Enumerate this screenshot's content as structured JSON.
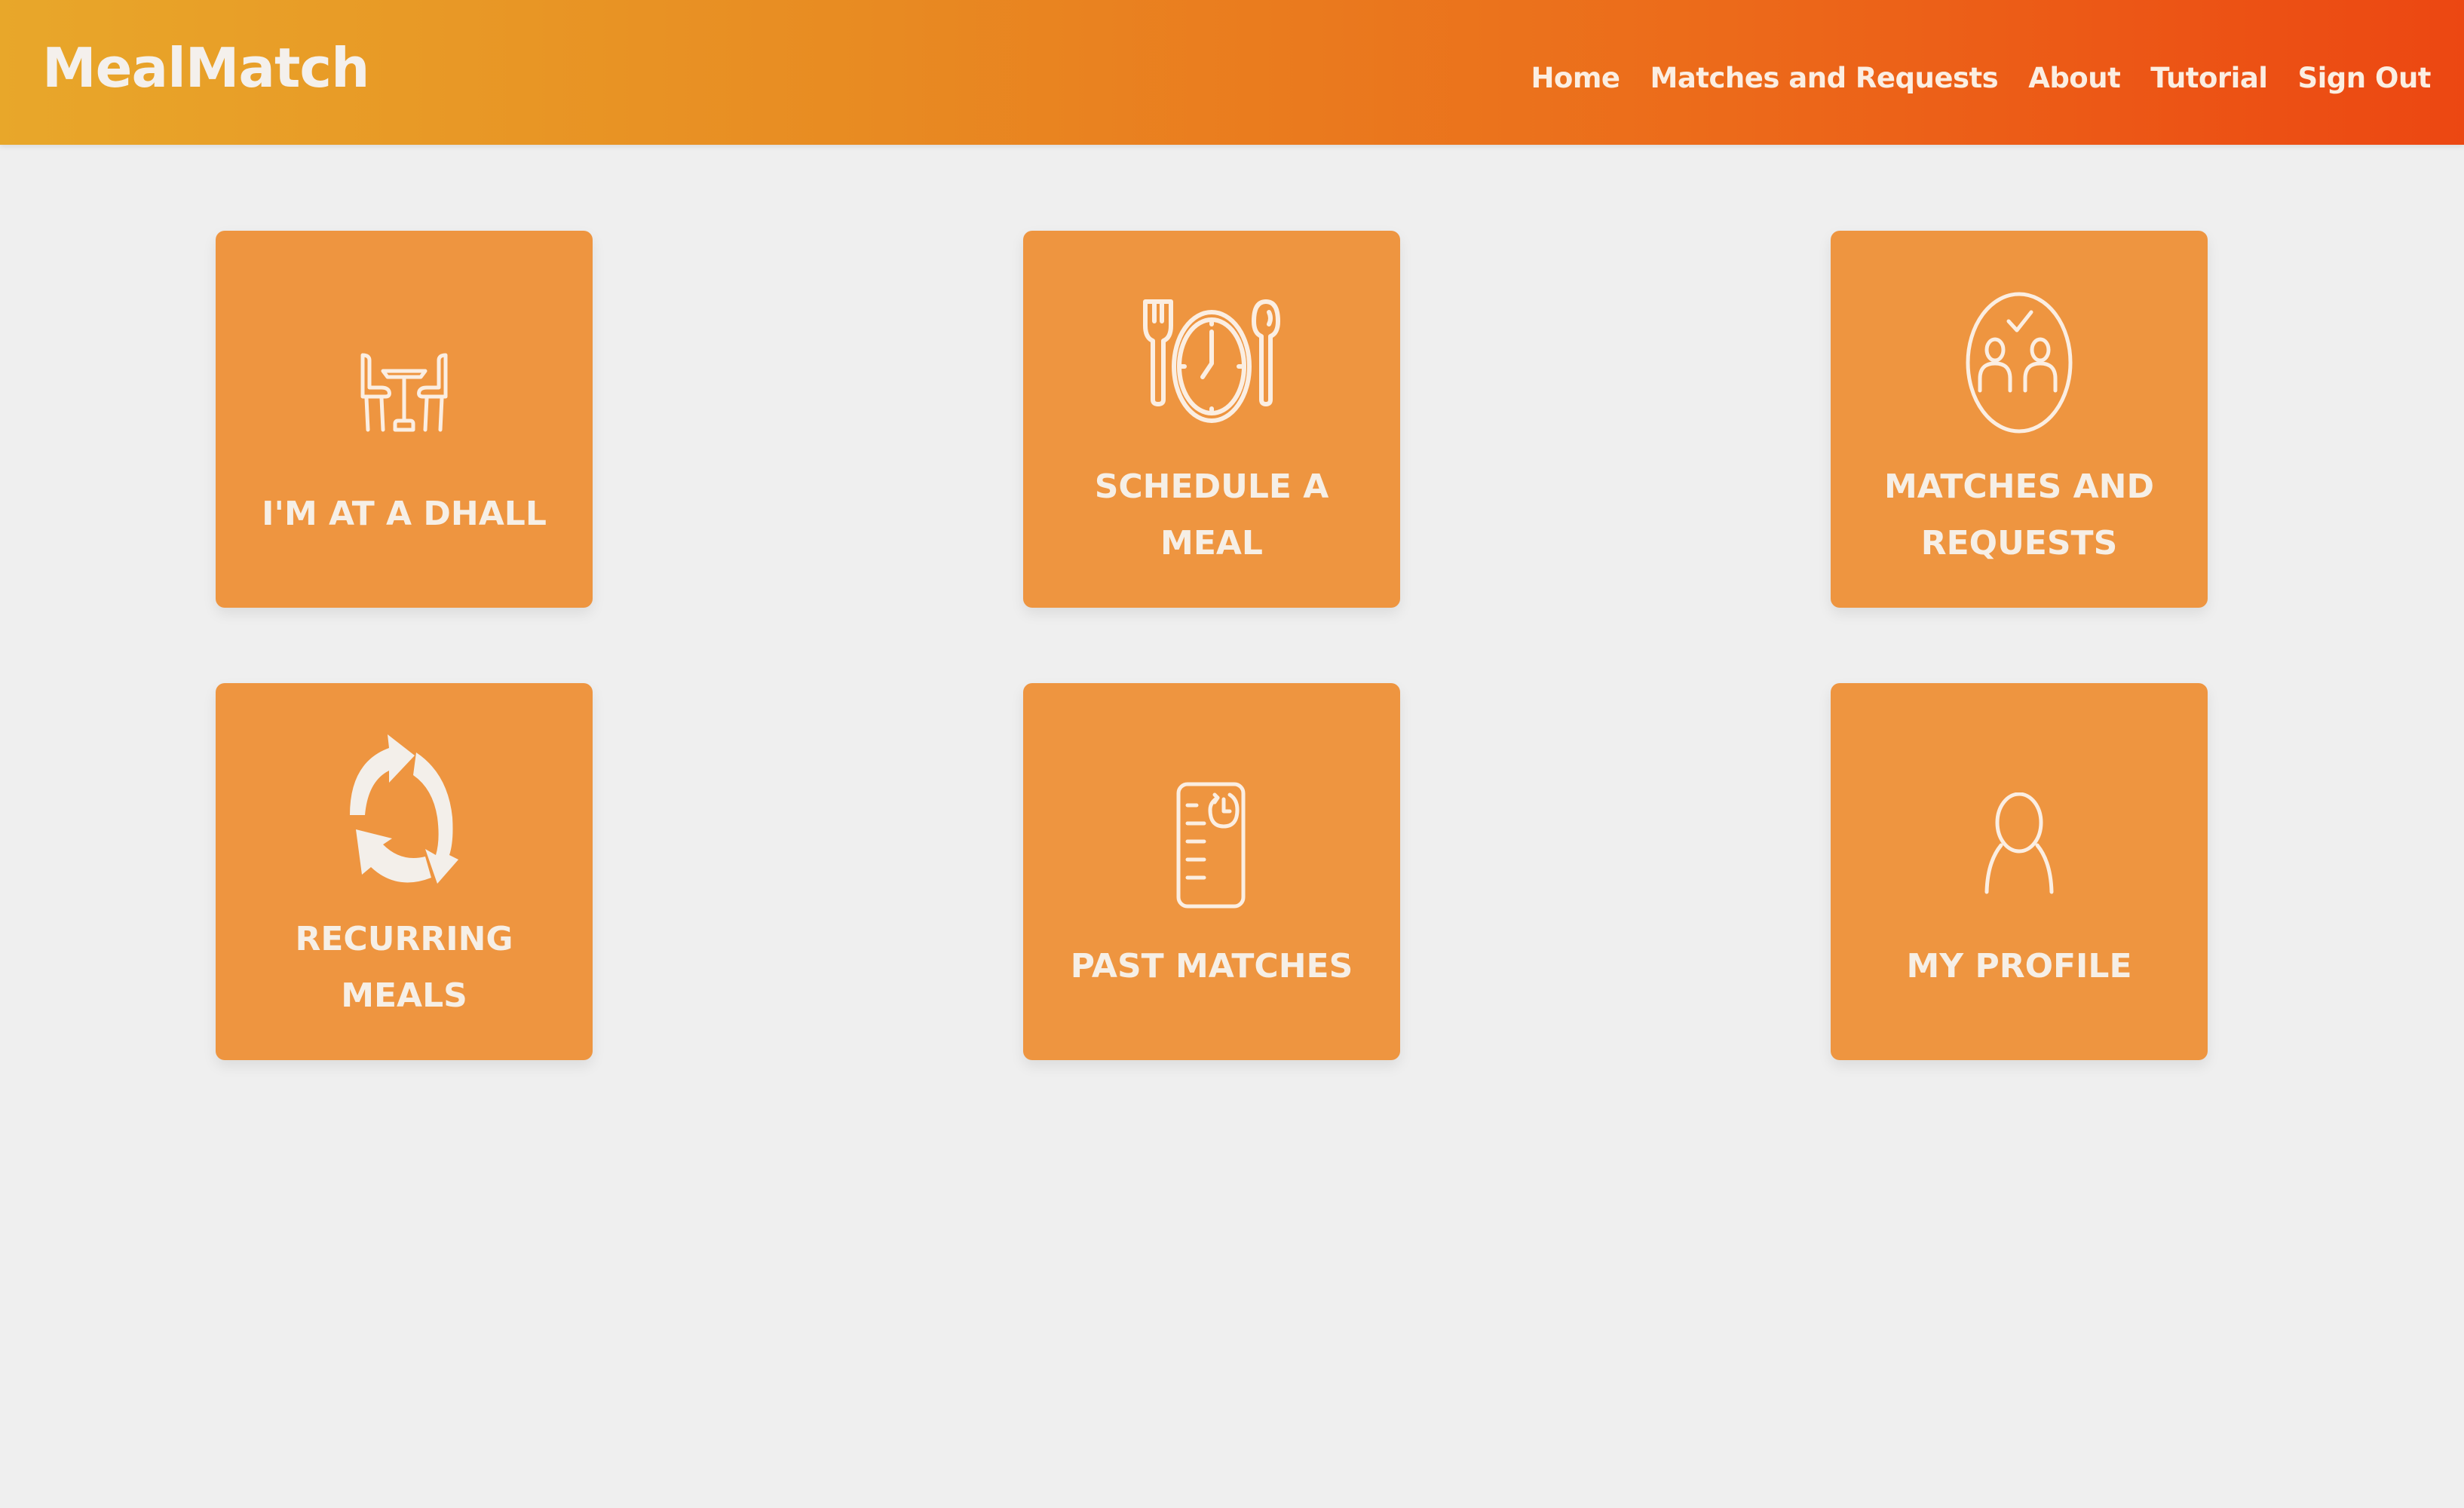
{
  "header": {
    "brand": "MealMatch",
    "nav": [
      "Home",
      "Matches and Requests",
      "About",
      "Tutorial",
      "Sign Out"
    ]
  },
  "tiles": [
    {
      "label": "I'M AT A DHALL",
      "icon": "dining-table-icon"
    },
    {
      "label": "SCHEDULE A MEAL",
      "icon": "plate-clock-icon"
    },
    {
      "label": "MATCHES AND REQUESTS",
      "icon": "people-check-icon"
    },
    {
      "label": "RECURRING MEALS",
      "icon": "recycle-arrows-icon"
    },
    {
      "label": "PAST MATCHES",
      "icon": "history-list-icon"
    },
    {
      "label": "MY PROFILE",
      "icon": "user-icon"
    }
  ],
  "colors": {
    "header_gradient_start": "#e8a72a",
    "header_gradient_end": "#ec4712",
    "tile": "#ee9540",
    "tile_text": "#f6efe6",
    "background": "#efefef"
  }
}
